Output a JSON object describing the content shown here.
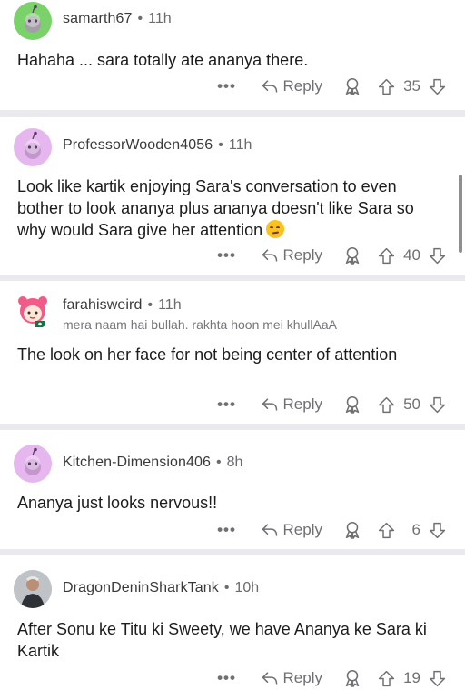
{
  "comments": [
    {
      "username": "samarth67",
      "time": "11h",
      "flair": "",
      "body": "Hahaha ... sara totally ate ananya there.",
      "reply_label": "Reply",
      "score": "35",
      "avatar_color": "#7bd16a"
    },
    {
      "username": "ProfessorWooden4056",
      "time": "11h",
      "flair": "",
      "body": "Look like kartik enjoying Sara's conversation to even bother to look ananya plus ananya doesn't like Sara so why would Sara give her attention",
      "reply_label": "Reply",
      "score": "40",
      "avatar_color": "#e6b6ef"
    },
    {
      "username": "farahisweird",
      "time": "11h",
      "flair": "mera naam hai bullah. rakhta hoon mei khullAaA",
      "body": "The look on her face for not being center of attention",
      "reply_label": "Reply",
      "score": "50",
      "avatar_color": "#f25a8a"
    },
    {
      "username": "Kitchen-Dimension406",
      "time": "8h",
      "flair": "",
      "body": "Ananya just looks nervous!!",
      "reply_label": "Reply",
      "score": "6",
      "avatar_color": "#e6b6ef"
    },
    {
      "username": "DragonDeninSharkTank",
      "time": "10h",
      "flair": "",
      "body": "After Sonu ke Titu ki Sweety, we have Ananya ke Sara ki Kartik",
      "reply_label": "Reply",
      "score": "19",
      "avatar_color": "#c9c9c9"
    }
  ],
  "separator": "•",
  "more_label": "•••"
}
